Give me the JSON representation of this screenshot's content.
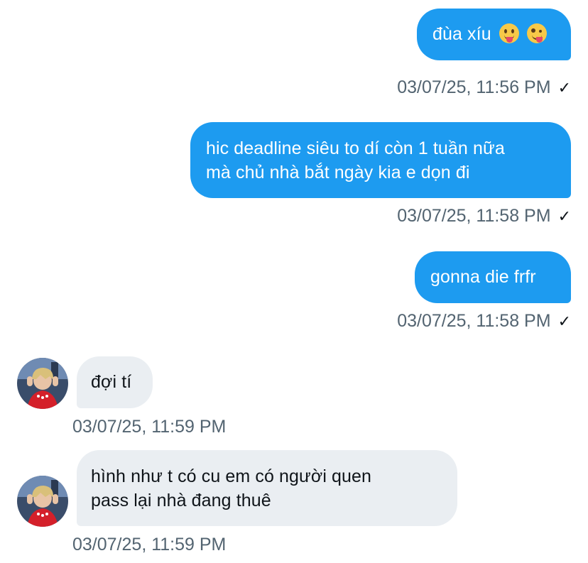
{
  "colors": {
    "outgoing_bubble": "#1D9BF0",
    "incoming_bubble": "#EAEEF2",
    "timestamp": "#536471",
    "text_dark": "#0F1419"
  },
  "messages": [
    {
      "direction": "outgoing",
      "text": "đùa xíu",
      "emoji": [
        "face-with-tongue-emoji",
        "zany-face-emoji"
      ],
      "timestamp": "03/07/25, 11:56 PM",
      "status": "✓"
    },
    {
      "direction": "outgoing",
      "text": "hic deadline siêu to dí còn 1 tuần nữa\nmà chủ nhà bắt ngày kia e dọn đi",
      "timestamp": "03/07/25, 11:58 PM",
      "status": "✓"
    },
    {
      "direction": "outgoing",
      "text": "gonna die frfr",
      "timestamp": "03/07/25, 11:58 PM",
      "status": "✓"
    },
    {
      "direction": "incoming",
      "text": "đợi tí",
      "timestamp": "03/07/25, 11:59 PM"
    },
    {
      "direction": "incoming",
      "text": "hình như t có cu em có người quen\npass lại nhà đang thuê",
      "timestamp": "03/07/25, 11:59 PM"
    }
  ]
}
